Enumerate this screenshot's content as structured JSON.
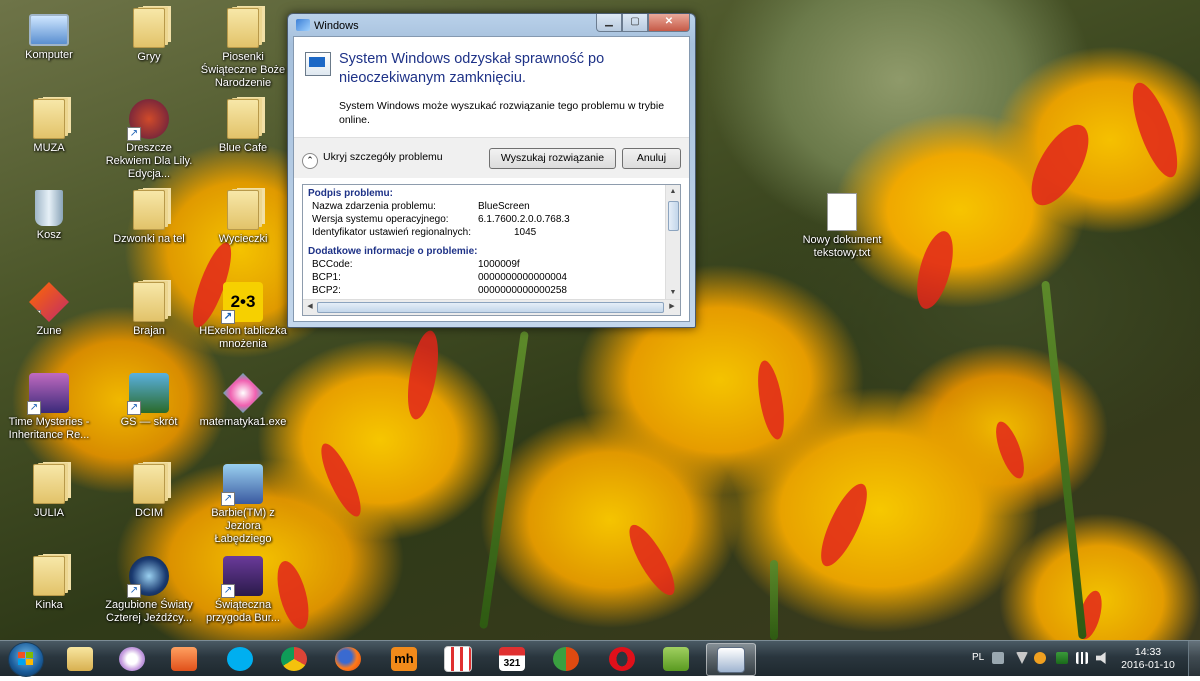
{
  "desktop_icons": [
    {
      "label": "Komputer",
      "icon": "computer-icon"
    },
    {
      "label": "Gryy",
      "icon": "folder-icon"
    },
    {
      "label": "Piosenki Świąteczne Boże Narodzenie",
      "icon": "folder-icon"
    },
    {
      "label": "MUZA",
      "icon": "folder-icon"
    },
    {
      "label": "Dreszcze Rekwiem Dla Lily. Edycja...",
      "icon": "game-shortcut-icon"
    },
    {
      "label": "Blue Cafe",
      "icon": "folder-icon"
    },
    {
      "label": "Kosz",
      "icon": "recycle-bin-icon"
    },
    {
      "label": "Dzwonki na tel",
      "icon": "folder-icon"
    },
    {
      "label": "Wycieczki",
      "icon": "folder-icon"
    },
    {
      "label": "Zune",
      "icon": "zune-shortcut-icon"
    },
    {
      "label": "Brajan",
      "icon": "folder-icon"
    },
    {
      "label": "HExelon tabliczka mnożenia",
      "icon": "app-shortcut-icon",
      "glyph": "2•3"
    },
    {
      "label": "Time Mysteries - Inheritance Re...",
      "icon": "game-shortcut-icon"
    },
    {
      "label": "GS — skrót",
      "icon": "game-shortcut-icon"
    },
    {
      "label": "matematyka1.exe",
      "icon": "exe-icon"
    },
    {
      "label": "JULIA",
      "icon": "folder-icon"
    },
    {
      "label": "DCIM",
      "icon": "folder-icon"
    },
    {
      "label": "Barbie(TM) z Jeziora Łabędziego",
      "icon": "game-shortcut-icon"
    },
    {
      "label": "Kinka",
      "icon": "folder-icon"
    },
    {
      "label": "Zagubione Światy Czterej Jeźdźcy...",
      "icon": "game-shortcut-icon"
    },
    {
      "label": "Świąteczna przygoda Bur...",
      "icon": "game-shortcut-icon"
    },
    {
      "label": "Nowy dokument tekstowy.txt",
      "icon": "text-document-icon"
    }
  ],
  "dialog": {
    "title": "Windows",
    "main_message": "System Windows odzyskał sprawność po nieoczekiwanym zamknięciu.",
    "sub_message": "System Windows może wyszukać rozwiązanie tego problemu w trybie online.",
    "toggle_label": "Ukryj szczegóły problemu",
    "search_button": "Wyszukaj rozwiązanie",
    "cancel_button": "Anuluj",
    "min_glyph": "▁",
    "max_glyph": "▢",
    "close_glyph": "✕",
    "toggle_glyph": "⌃",
    "scroll_up_glyph": "▲",
    "scroll_down_glyph": "▼",
    "scroll_left_glyph": "◀",
    "scroll_right_glyph": "▶",
    "details": {
      "section1_title": "Podpis problemu:",
      "rows1": [
        {
          "key": "Nazwa zdarzenia problemu:",
          "value": "BlueScreen"
        },
        {
          "key": "Wersja systemu operacyjnego:",
          "value": "6.1.7600.2.0.0.768.3"
        },
        {
          "key": "Identyfikator ustawień regionalnych:",
          "value": "1045"
        }
      ],
      "section2_title": "Dodatkowe informacje o problemie:",
      "rows2": [
        {
          "key": "BCCode:",
          "value": "1000009f"
        },
        {
          "key": "BCP1:",
          "value": "0000000000000004"
        },
        {
          "key": "BCP2:",
          "value": "0000000000000258"
        }
      ]
    }
  },
  "taskbar": {
    "apps": [
      "start-button",
      "explorer-icon",
      "itunes-icon",
      "media-player-icon",
      "skype-icon",
      "chrome-icon",
      "firefox-icon",
      "mh-icon",
      "apps-grid-icon",
      "calendar-321-icon",
      "refresh-app-icon",
      "opera-icon",
      "media-monkey-icon",
      "action-center-window-icon"
    ],
    "mh_label": "mh",
    "calendar_label": "321",
    "language": "PL",
    "time": "14:33",
    "date": "2016-01-10"
  }
}
